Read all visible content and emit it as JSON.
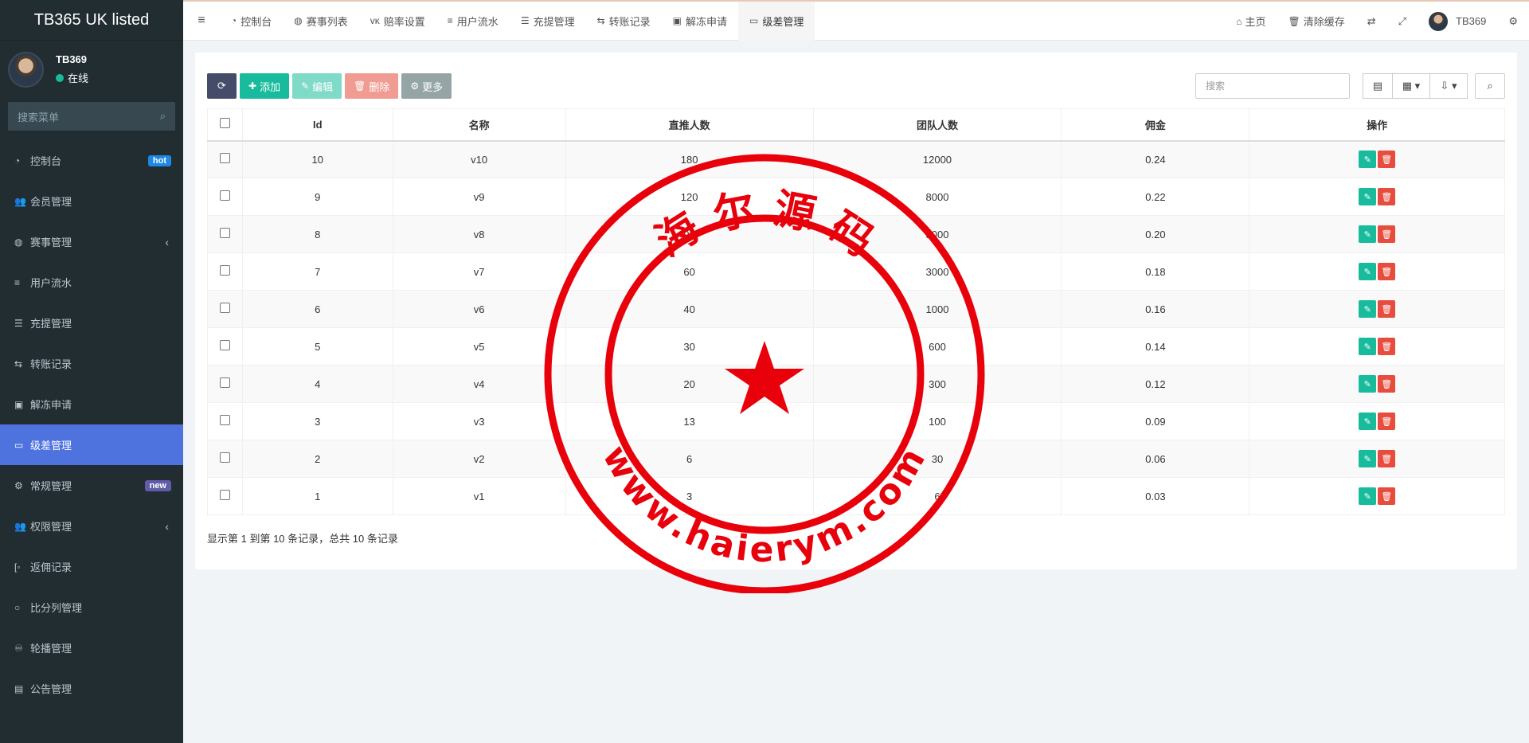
{
  "brand": "TB365 UK listed",
  "user": {
    "name": "TB369",
    "status": "在线"
  },
  "menu_search_placeholder": "搜索菜单",
  "menu": [
    {
      "label": "控制台",
      "icon": "dashboard-icon",
      "badge": "hot"
    },
    {
      "label": "会员管理",
      "icon": "users-icon"
    },
    {
      "label": "赛事管理",
      "icon": "globe-icon",
      "caret": "‹"
    },
    {
      "label": "用户流水",
      "icon": "list-icon"
    },
    {
      "label": "充提管理",
      "icon": "list-alt-icon"
    },
    {
      "label": "转账记录",
      "icon": "transfer-icon"
    },
    {
      "label": "解冻申请",
      "icon": "image-icon"
    },
    {
      "label": "级差管理",
      "icon": "window-icon",
      "active": true
    },
    {
      "label": "常规管理",
      "icon": "cogs-icon",
      "badge": "new"
    },
    {
      "label": "权限管理",
      "icon": "group-icon",
      "caret": "‹"
    },
    {
      "label": "返佣记录",
      "icon": "bracket-icon"
    },
    {
      "label": "比分列管理",
      "icon": "circle-icon"
    },
    {
      "label": "轮播管理",
      "icon": "carousel-icon"
    },
    {
      "label": "公告管理",
      "icon": "notice-icon"
    }
  ],
  "tabs": [
    {
      "label": "控制台",
      "icon": "dashboard-icon"
    },
    {
      "label": "赛事列表",
      "icon": "globe-icon"
    },
    {
      "label": "赔率设置",
      "icon": "vk-icon"
    },
    {
      "label": "用户流水",
      "icon": "list-icon"
    },
    {
      "label": "充提管理",
      "icon": "list-alt-icon"
    },
    {
      "label": "转账记录",
      "icon": "transfer-icon"
    },
    {
      "label": "解冻申请",
      "icon": "image-icon"
    },
    {
      "label": "级差管理",
      "icon": "window-icon",
      "active": true
    }
  ],
  "topright": {
    "home": "主页",
    "clear_cache": "清除缓存",
    "username": "TB369"
  },
  "toolbar": {
    "add": "添加",
    "edit": "编辑",
    "delete": "删除",
    "more": "更多"
  },
  "search_placeholder": "搜索",
  "table": {
    "columns": [
      "Id",
      "名称",
      "直推人数",
      "团队人数",
      "佣金",
      "操作"
    ],
    "rows": [
      [
        "10",
        "v10",
        "180",
        "12000",
        "0.24"
      ],
      [
        "9",
        "v9",
        "120",
        "8000",
        "0.22"
      ],
      [
        "8",
        "v8",
        "90",
        "5000",
        "0.20"
      ],
      [
        "7",
        "v7",
        "60",
        "3000",
        "0.18"
      ],
      [
        "6",
        "v6",
        "40",
        "1000",
        "0.16"
      ],
      [
        "5",
        "v5",
        "30",
        "600",
        "0.14"
      ],
      [
        "4",
        "v4",
        "20",
        "300",
        "0.12"
      ],
      [
        "3",
        "v3",
        "13",
        "100",
        "0.09"
      ],
      [
        "2",
        "v2",
        "6",
        "30",
        "0.06"
      ],
      [
        "1",
        "v1",
        "3",
        "6",
        "0.03"
      ]
    ]
  },
  "pagination_text": "显示第 1 到第 10 条记录，总共 10 条记录",
  "watermark": {
    "top_text": "海 尔 源 码",
    "bottom_text": "www.haierym.com",
    "color": "#e8000b"
  }
}
